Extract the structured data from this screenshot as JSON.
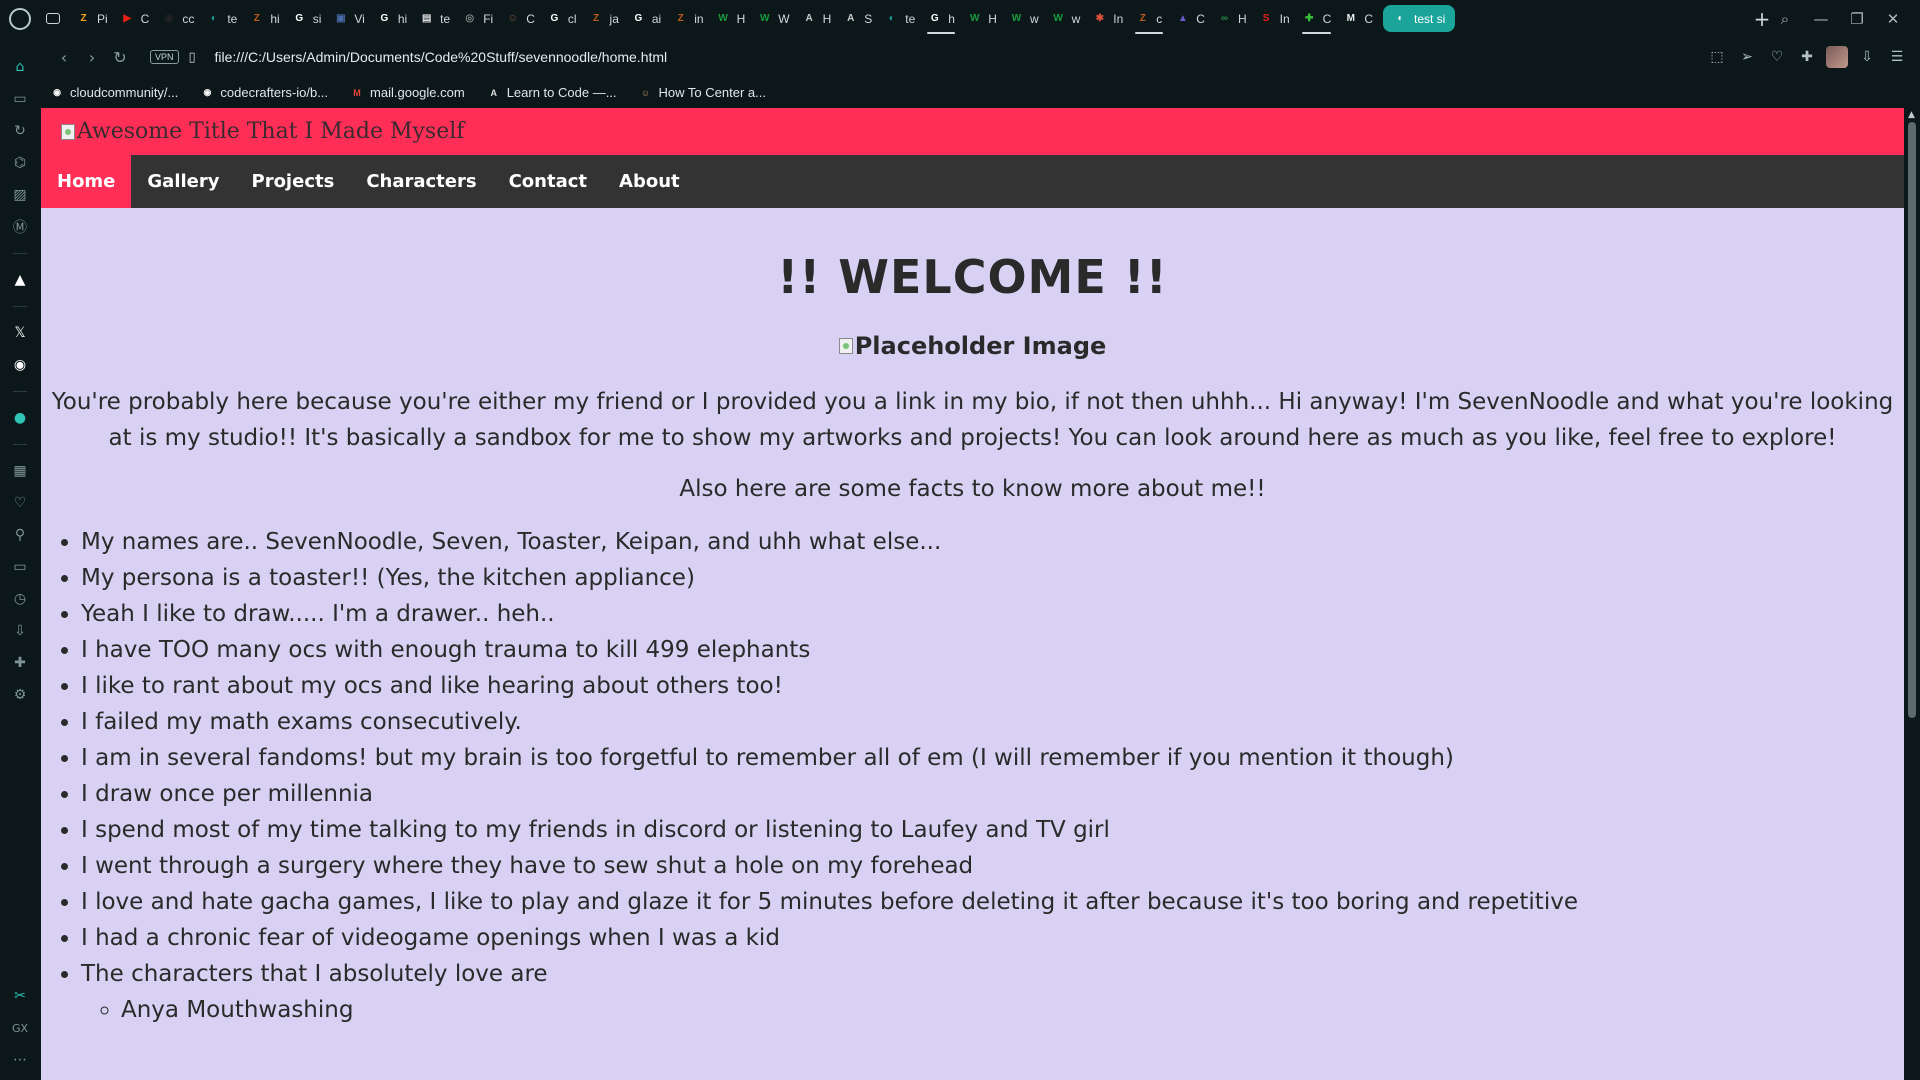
{
  "browser": {
    "tabs": [
      {
        "label": "Pi",
        "color": "#f7a21b",
        "glyph": "Z"
      },
      {
        "label": "C",
        "color": "#e62117",
        "glyph": "▶"
      },
      {
        "label": "cc",
        "color": "#222",
        "glyph": "◉"
      },
      {
        "label": "te",
        "color": "#1aa49a",
        "glyph": "◐"
      },
      {
        "label": "hi",
        "color": "#c05a1a",
        "glyph": "Z"
      },
      {
        "label": "si",
        "color": "#ffffff",
        "glyph": "G"
      },
      {
        "label": "Vi",
        "color": "#4a6aa8",
        "glyph": "▣"
      },
      {
        "label": "hi",
        "color": "#ffffff",
        "glyph": "G"
      },
      {
        "label": "te",
        "color": "#dddddd",
        "glyph": "▤"
      },
      {
        "label": "Fi",
        "color": "#888888",
        "glyph": "◎"
      },
      {
        "label": "C",
        "color": "#8a5a3a",
        "glyph": "☺"
      },
      {
        "label": "cl",
        "color": "#ffffff",
        "glyph": "G"
      },
      {
        "label": "ja",
        "color": "#c05a1a",
        "glyph": "Z"
      },
      {
        "label": "ai",
        "color": "#ffffff",
        "glyph": "G"
      },
      {
        "label": "in",
        "color": "#c05a1a",
        "glyph": "Z"
      },
      {
        "label": "H",
        "color": "#1a9c3e",
        "glyph": "W"
      },
      {
        "label": "W",
        "color": "#1a9c3e",
        "glyph": "W"
      },
      {
        "label": "H",
        "color": "#cccccc",
        "glyph": "A"
      },
      {
        "label": "S",
        "color": "#cccccc",
        "glyph": "A"
      },
      {
        "label": "te",
        "color": "#1aa49a",
        "glyph": "◐"
      },
      {
        "label": "h",
        "color": "#ffffff",
        "glyph": "G"
      },
      {
        "label": "H",
        "color": "#1a9c3e",
        "glyph": "W"
      },
      {
        "label": "w",
        "color": "#1a9c3e",
        "glyph": "W"
      },
      {
        "label": "w",
        "color": "#1a9c3e",
        "glyph": "W"
      },
      {
        "label": "In",
        "color": "#e0503a",
        "glyph": "✱"
      },
      {
        "label": "c",
        "color": "#c05a1a",
        "glyph": "Z"
      },
      {
        "label": "C",
        "color": "#6a5acd",
        "glyph": "▲"
      },
      {
        "label": "H",
        "color": "#2a8a4a",
        "glyph": "∞"
      },
      {
        "label": "In",
        "color": "#e62117",
        "glyph": "S"
      },
      {
        "label": "C",
        "color": "#3ac23a",
        "glyph": "✚"
      },
      {
        "label": "C",
        "color": "#eeeeee",
        "glyph": "M"
      },
      {
        "label": "test si",
        "color": "#ffffff",
        "glyph": "◐",
        "active": true
      }
    ],
    "address": {
      "url": "file:///C:/Users/Admin/Documents/Code%20Stuff/sevennoodle/home.html",
      "vpn_label": "VPN"
    },
    "bookmarks": [
      {
        "label": "cloudcommunity/...",
        "color": "#ffffff",
        "glyph": "◉"
      },
      {
        "label": "codecrafters-io/b...",
        "color": "#ffffff",
        "glyph": "◉"
      },
      {
        "label": "mail.google.com",
        "color": "#e94235",
        "glyph": "M"
      },
      {
        "label": "Learn to Code —...",
        "color": "#dddddd",
        "glyph": "A"
      },
      {
        "label": "How To Center a...",
        "color": "#c08a5a",
        "glyph": "☺"
      }
    ]
  },
  "site": {
    "header_image_alt": "Awesome Title That I Made Myself",
    "nav": [
      "Home",
      "Gallery",
      "Projects",
      "Characters",
      "Contact",
      "About"
    ],
    "nav_active": "Home",
    "accent_color": "#ff2e57",
    "background_color": "#d8d1f3",
    "welcome": "!! WELCOME !!",
    "placeholder_alt": "Placeholder Image",
    "intro": "You're probably here because you're either my friend or I provided you a link in my bio, if not then uhhh... Hi anyway! I'm SevenNoodle and what you're looking at is my studio!! It's basically a sandbox for me to show my artworks and projects! You can look around here as much as you like, feel free to explore!",
    "facts_lead": "Also here are some facts to know more about me!!",
    "facts": [
      "My names are.. SevenNoodle, Seven, Toaster, Keipan, and uhh what else...",
      "My persona is a toaster!! (Yes, the kitchen appliance)",
      "Yeah I like to draw..... I'm a drawer.. heh..",
      "I have TOO many ocs with enough trauma to kill 499 elephants",
      "I like to rant about my ocs and like hearing about others too!",
      "I failed my math exams consecutively.",
      "I am in several fandoms! but my brain is too forgetful to remember all of em (I will remember if you mention it though)",
      "I draw once per millennia",
      "I spend most of my time talking to my friends in discord or listening to Laufey and TV girl",
      "I went through a surgery where they have to sew shut a hole on my forehead",
      "I love and hate gacha games, I like to play and glaze it for 5 minutes before deleting it after because it's too boring and repetitive",
      "I had a chronic fear of videogame openings when I was a kid",
      "The characters that I absolutely love are"
    ],
    "characters": [
      "Anya Mouthwashing"
    ]
  }
}
